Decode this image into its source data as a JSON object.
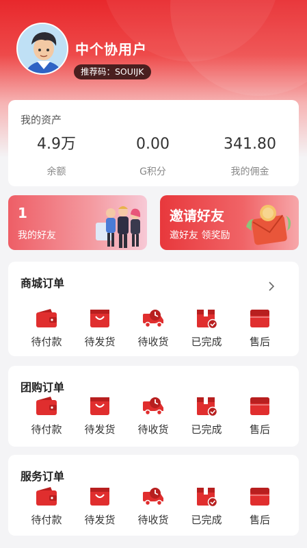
{
  "profile": {
    "username": "中个协用户",
    "referral_code": "推荐码：SOUIJK"
  },
  "assets": {
    "title": "我的资产",
    "items": [
      {
        "value": "4.9万",
        "label": "余额"
      },
      {
        "value": "0.00",
        "label": "G积分"
      },
      {
        "value": "341.80",
        "label": "我的佣金"
      }
    ]
  },
  "promos": {
    "friends": {
      "count": "1",
      "label": "我的好友"
    },
    "invite": {
      "title": "邀请好友",
      "subtitle": "邀好友 领奖励"
    }
  },
  "order_item_labels": [
    "待付款",
    "待发货",
    "待收货",
    "已完成",
    "售后"
  ],
  "sections": [
    {
      "title": "商城订单"
    },
    {
      "title": "团购订单"
    },
    {
      "title": "服务订单"
    }
  ],
  "icons": [
    "wallet-icon",
    "shopping-bag-icon",
    "delivery-truck-icon",
    "completed-box-icon",
    "after-sales-icon"
  ],
  "colors": {
    "brand_red": "#e02e2e"
  }
}
